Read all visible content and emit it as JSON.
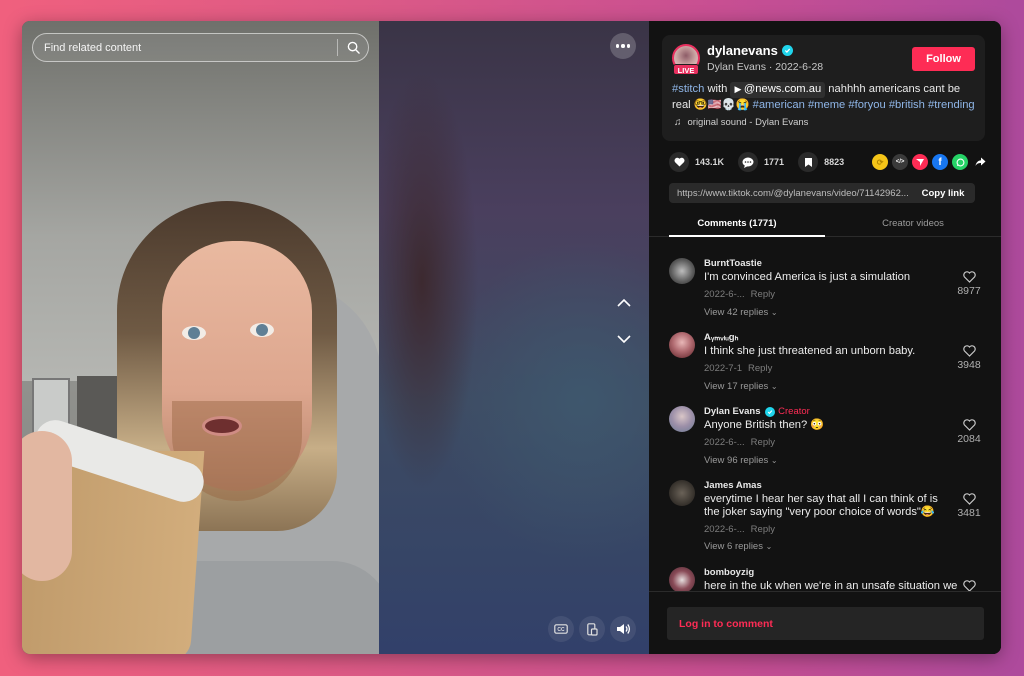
{
  "video": {
    "search_placeholder": "Find related content",
    "icons": {
      "search": "search-icon",
      "more": "more-options-icon",
      "prev": "chevron-up-icon",
      "next": "chevron-down-icon",
      "captions": "closed-captions-icon",
      "picture_in_picture": "floating-player-icon",
      "volume": "volume-icon"
    }
  },
  "author": {
    "username": "dylanevans",
    "display_name": "Dylan Evans",
    "date": "2022-6-28",
    "subline": "Dylan Evans · 2022-6-28",
    "live_badge": "LIVE",
    "verified": true,
    "follow_label": "Follow"
  },
  "description": {
    "stitch_tag": "#stitch",
    "with_text": " with ",
    "mention": "@news.com.au",
    "text": " nahhhh americans cant be real ",
    "emojis": "🤓🇺🇸💀😭",
    "hashtags": [
      "#american",
      "#meme",
      "#foryou",
      "#british",
      "#trending"
    ]
  },
  "sound": {
    "label": "original sound - Dylan Evans"
  },
  "stats": {
    "likes": "143.1K",
    "comments": "1771",
    "saves": "8823"
  },
  "share": {
    "targets": [
      "repost",
      "embed",
      "send-to-friends",
      "facebook",
      "whatsapp",
      "more-share"
    ],
    "link": "https://www.tiktok.com/@dylanevans/video/71142962...",
    "copy_label": "Copy link"
  },
  "tabs": [
    {
      "label": "Comments (1771)",
      "active": true
    },
    {
      "label": "Creator videos",
      "active": false
    }
  ],
  "comments": [
    {
      "user": "BurntToastie",
      "text": "I'm convinced America is just a simulation",
      "date": "2022-6-...",
      "reply_label": "Reply",
      "likes": "8977",
      "replies_label": "View 42 replies",
      "is_creator": false
    },
    {
      "user": "Aᵧₘᵥₗᵤgₕ",
      "text": "I think she just threatened an unborn baby.",
      "date": "2022-7-1",
      "reply_label": "Reply",
      "likes": "3948",
      "replies_label": "View 17 replies",
      "is_creator": false
    },
    {
      "user": "Dylan Evans",
      "creator_label": "Creator",
      "text": "Anyone British then? 😳",
      "date": "2022-6-...",
      "reply_label": "Reply",
      "likes": "2084",
      "replies_label": "View 96 replies",
      "is_creator": true
    },
    {
      "user": "James Amas",
      "text": "everytime I hear her say that all I can think of is the joker saying \"very poor choice of words\"😂",
      "date": "2022-6-...",
      "reply_label": "Reply",
      "likes": "3481",
      "replies_label": "View 6 replies",
      "is_creator": false
    },
    {
      "user": "bomboyzig",
      "text": "here in the uk when we're in an unsafe situation we",
      "is_creator": false
    }
  ],
  "footer": {
    "login_label": "Log in to comment"
  },
  "colors": {
    "accent": "#fe2c55",
    "hashtag": "#8fb6e8",
    "verified": "#20d5ec",
    "panel_bg": "#121212"
  }
}
